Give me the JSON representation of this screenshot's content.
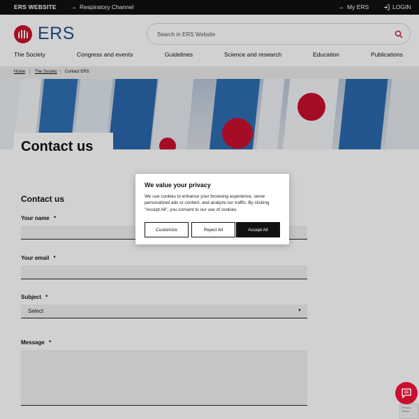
{
  "topbar": {
    "site_label": "ERS WEBSITE",
    "respiratory_label": "Respiratory Channel",
    "my_ers_label": "My ERS",
    "login_label": "LOGIN"
  },
  "header": {
    "logo_text": "ERS",
    "search_placeholder": "Search in ERS Website"
  },
  "nav": {
    "items": [
      {
        "label": "The Society"
      },
      {
        "label": "Congress and events"
      },
      {
        "label": "Guidelines"
      },
      {
        "label": "Science and research"
      },
      {
        "label": "Education"
      },
      {
        "label": "Publications"
      }
    ]
  },
  "breadcrumb": {
    "home": "Home",
    "society": "The Society",
    "current": "Contact ERS"
  },
  "hero": {
    "title": "Contact us"
  },
  "form": {
    "heading": "Contact us",
    "name_label": "Your name",
    "email_label": "Your email",
    "subject_label": "Subject",
    "subject_value": "Select",
    "message_label": "Message",
    "required_mark": "*"
  },
  "cookie": {
    "title": "We value your privacy",
    "text": "We use cookies to enhance your browsing experience, serve personalized ads or content, and analyze our traffic. By clicking \"Accept All\", you consent to our use of cookies.",
    "customize_label": "Customize",
    "reject_label": "Reject All",
    "accept_label": "Accept All"
  },
  "colors": {
    "brand_red": "#c8102e",
    "brand_blue": "#1f4e8c",
    "topbar_bg": "#111111"
  },
  "icons": {
    "search": "search-icon",
    "chat": "chat-icon",
    "login": "login-icon"
  }
}
